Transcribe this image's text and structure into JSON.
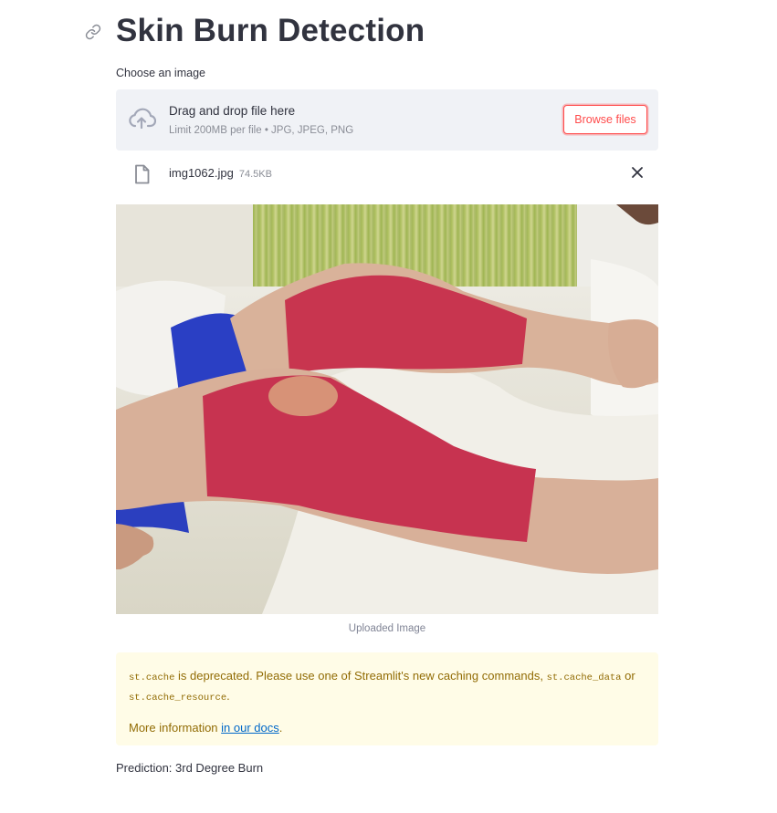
{
  "page": {
    "title": "Skin Burn Detection"
  },
  "uploader": {
    "label": "Choose an image",
    "dropzone_title": "Drag and drop file here",
    "dropzone_hint": "Limit 200MB per file • JPG, JPEG, PNG",
    "browse_label": "Browse files",
    "file_name": "img1062.jpg",
    "file_size": "74.5KB"
  },
  "image": {
    "caption": "Uploaded Image"
  },
  "warning": {
    "code1": "st.cache",
    "text1": " is deprecated. Please use one of Streamlit's new caching commands, ",
    "code2": "st.cache_data",
    "text2": " or ",
    "code3": "st.cache_resource",
    "text3": ".",
    "more_prefix": "More information ",
    "link_text": "in our docs",
    "more_suffix": "."
  },
  "result": {
    "prediction": "Prediction: 3rd Degree Burn"
  },
  "colors": {
    "accent": "#ff4b4b",
    "text": "#31333f",
    "dropzone_bg": "#f0f2f6",
    "warning_bg": "#fffce7",
    "warning_text": "#926c05",
    "link": "#0068c9"
  },
  "icons": {
    "anchor": "link-icon",
    "upload": "cloud-upload-icon",
    "file": "file-icon",
    "remove": "close-icon"
  }
}
